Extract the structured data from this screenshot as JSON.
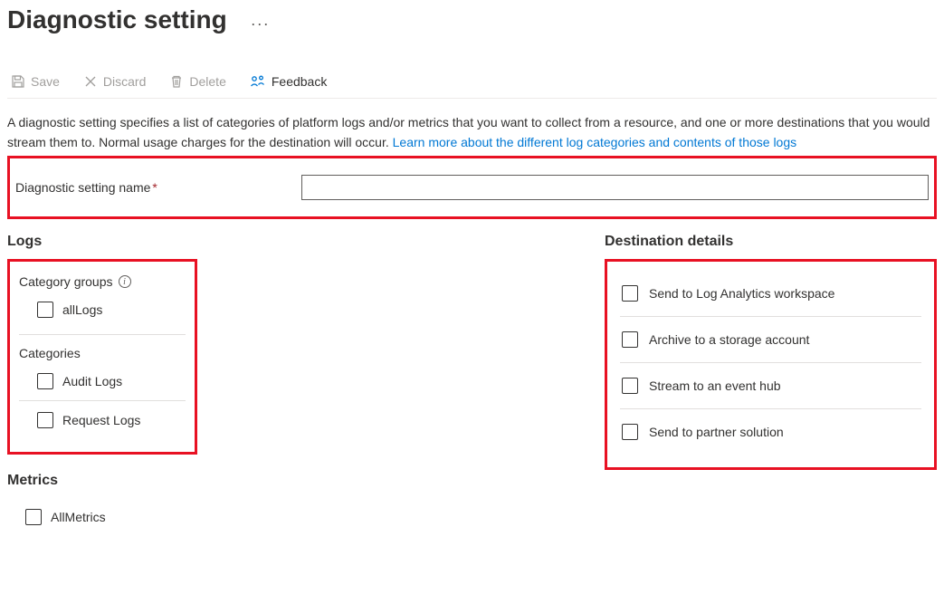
{
  "page": {
    "title": "Diagnostic setting"
  },
  "toolbar": {
    "save": "Save",
    "discard": "Discard",
    "delete": "Delete",
    "feedback": "Feedback"
  },
  "description": {
    "text": "A diagnostic setting specifies a list of categories of platform logs and/or metrics that you want to collect from a resource, and one or more destinations that you would stream them to. Normal usage charges for the destination will occur. ",
    "link": "Learn more about the different log categories and contents of those logs"
  },
  "nameField": {
    "label": "Diagnostic setting name",
    "value": ""
  },
  "logs": {
    "heading": "Logs",
    "categoryGroupsHeading": "Category groups",
    "allLogs": "allLogs",
    "categoriesHeading": "Categories",
    "items": [
      "Audit Logs",
      "Request Logs"
    ]
  },
  "metrics": {
    "heading": "Metrics",
    "allMetrics": "AllMetrics"
  },
  "destinations": {
    "heading": "Destination details",
    "items": [
      "Send to Log Analytics workspace",
      "Archive to a storage account",
      "Stream to an event hub",
      "Send to partner solution"
    ]
  }
}
